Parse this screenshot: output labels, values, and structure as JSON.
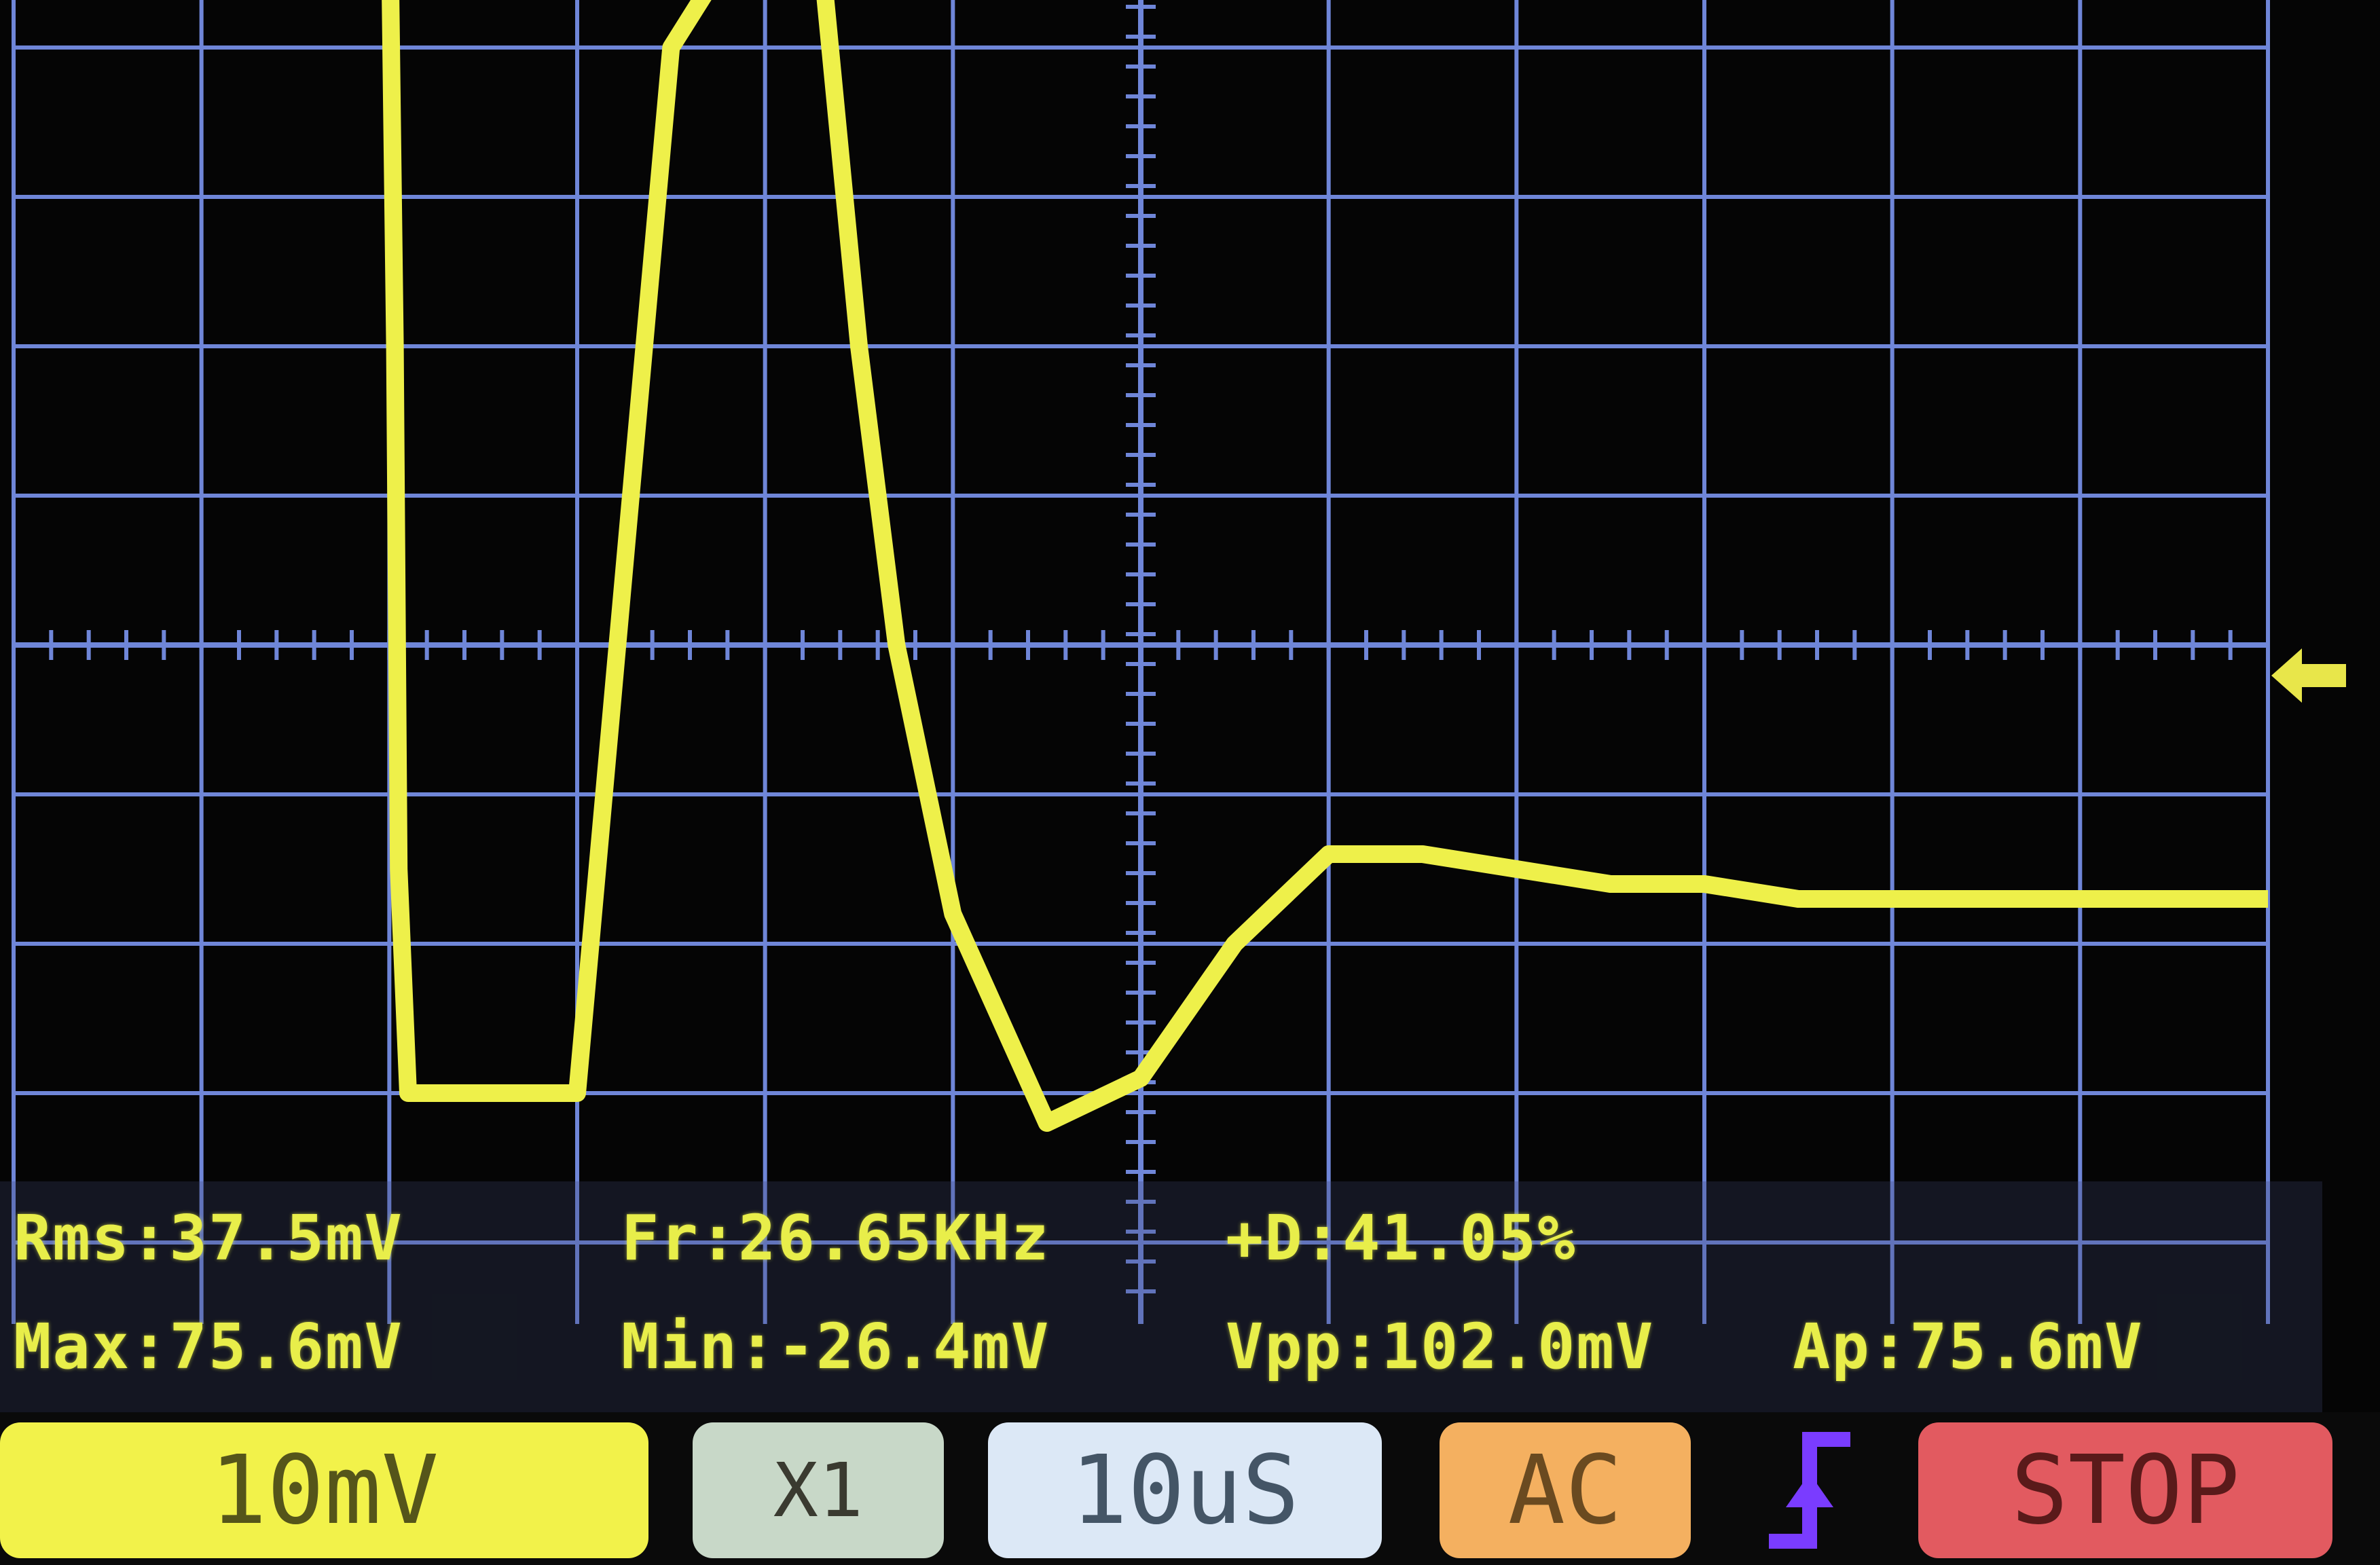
{
  "buttons": {
    "volts_div": "10mV",
    "probe": "X1",
    "time_div": "10uS",
    "coupling": "AC",
    "run_state": "STOP"
  },
  "measurements": {
    "rms": "Rms:37.5mV",
    "freq": "Fr:26.65KHz",
    "duty": "+D:41.05%",
    "max": "Max:75.6mV",
    "min": "Min:-26.4mV",
    "vpp": "Vpp:102.0mV",
    "ap": "Ap:75.6mV"
  },
  "colors": {
    "trace": "#eef04a",
    "grid": "#6f86d8",
    "background": "#050505"
  },
  "icons": {
    "trigger": "rising-edge-trigger-icon",
    "trigger_level": "trigger-level-arrow-icon"
  },
  "chart_data": {
    "type": "line",
    "title": "",
    "xlabel": "",
    "ylabel": "",
    "divisions_x": 12,
    "divisions_y": 8,
    "series": [
      {
        "x": [
          0.0,
          1.0,
          1.8,
          2.0,
          2.03,
          2.05,
          2.1,
          3.0,
          3.5,
          4.0,
          4.3,
          4.5,
          4.7,
          5.0,
          5.5,
          6.0,
          6.5,
          7.0,
          7.5,
          8.0,
          8.5,
          9.0,
          9.5,
          10.0,
          10.5,
          11.0,
          11.5,
          12.0
        ],
        "y": [
          5.0,
          5.0,
          5.0,
          5.0,
          2.0,
          -1.5,
          -3.0,
          -3.0,
          4.0,
          5.0,
          4.6,
          2.0,
          0.0,
          -1.8,
          -3.2,
          -2.9,
          -2.0,
          -1.4,
          -1.4,
          -1.5,
          -1.6,
          -1.6,
          -1.7,
          -1.7,
          -1.7,
          -1.7,
          -1.7,
          -1.7
        ]
      }
    ]
  }
}
